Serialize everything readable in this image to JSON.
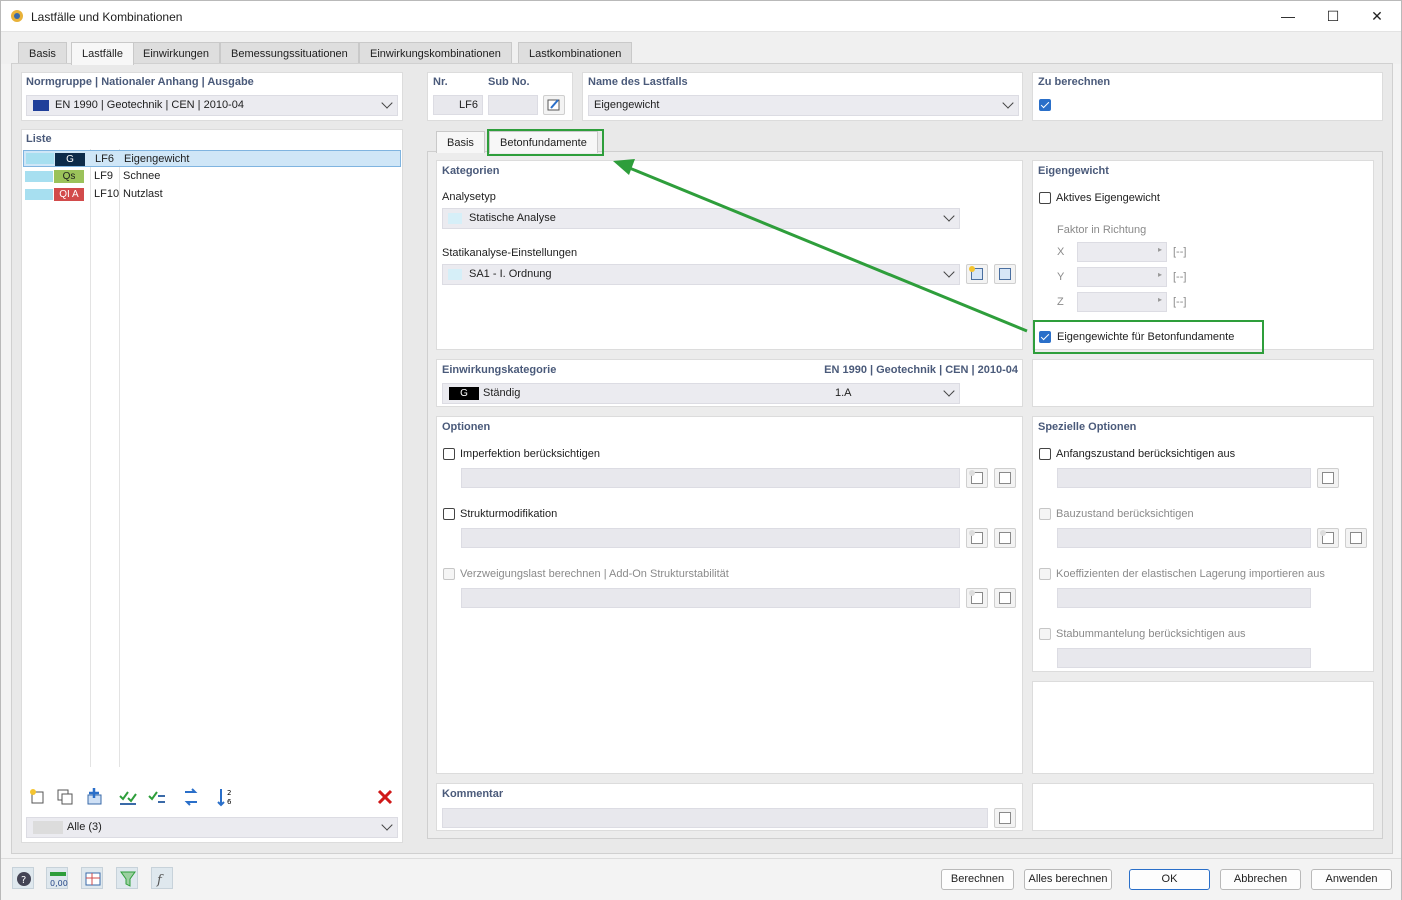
{
  "window": {
    "title": "Lastfälle und Kombinationen",
    "minimize": "—",
    "maximize": "☐",
    "close": "✕"
  },
  "tabs": [
    "Basis",
    "Lastfälle",
    "Einwirkungen",
    "Bemessungssituationen",
    "Einwirkungskombinationen",
    "Lastkombinationen"
  ],
  "active_tab": "Lastfälle",
  "left": {
    "norm_header": "Normgruppe | Nationaler Anhang | Ausgabe",
    "norm_value": "EN 1990 | Geotechnik | CEN | 2010-04",
    "list_header": "Liste",
    "items": [
      {
        "badge": "G",
        "no": "LF6",
        "name": "Eigengewicht",
        "badge_bg": "#0c2b4a",
        "badge_fg": "#ffffff"
      },
      {
        "badge": "Qs",
        "no": "LF9",
        "name": "Schnee",
        "badge_bg": "#9bc25a",
        "badge_fg": "#1e1e1e"
      },
      {
        "badge": "QI A",
        "no": "LF10",
        "name": "Nutzlast",
        "badge_bg": "#d24b4b",
        "badge_fg": "#ffffff"
      }
    ],
    "filter": "Alle (3)"
  },
  "top": {
    "nr_label": "Nr.",
    "nr_value": "LF6",
    "sub_label": "Sub No.",
    "name_label": "Name des Lastfalls",
    "name_value": "Eigengewicht",
    "calc_label": "Zu berechnen",
    "calc_checked": true
  },
  "subtabs": [
    "Basis",
    "Betonfundamente"
  ],
  "kategorien": {
    "header": "Kategorien",
    "analysetyp_label": "Analysetyp",
    "analysetyp_value": "Statische Analyse",
    "statik_label": "Statikanalyse-Einstellungen",
    "statik_value": "SA1 - I. Ordnung"
  },
  "eigengewicht": {
    "header": "Eigengewicht",
    "aktiv_label": "Aktives Eigengewicht",
    "aktiv_checked": false,
    "faktor_label": "Faktor in Richtung",
    "axes": [
      "X",
      "Y",
      "Z"
    ],
    "unit": "[--]",
    "beton_label": "Eigengewichte für Betonfundamente",
    "beton_checked": true
  },
  "einwirkung": {
    "header": "Einwirkungskategorie",
    "norm": "EN 1990 | Geotechnik | CEN | 2010-04",
    "badge": "G",
    "value": "Ständig",
    "code": "1.A"
  },
  "optionen": {
    "header": "Optionen",
    "items": [
      {
        "label": "Imperfektion berücksichtigen",
        "enabled": true
      },
      {
        "label": "Strukturmodifikation",
        "enabled": true
      },
      {
        "label": "Verzweigungslast berechnen | Add-On Strukturstabilität",
        "enabled": false
      }
    ]
  },
  "spezielle": {
    "header": "Spezielle Optionen",
    "items": [
      {
        "label": "Anfangszustand berücksichtigen aus",
        "enabled": true
      },
      {
        "label": "Bauzustand berücksichtigen",
        "enabled": false
      },
      {
        "label": "Koeffizienten der elastischen Lagerung importieren aus",
        "enabled": false
      },
      {
        "label": "Stabummantelung berücksichtigen aus",
        "enabled": false
      }
    ]
  },
  "kommentar": {
    "header": "Kommentar"
  },
  "buttons": {
    "berechnen": "Berechnen",
    "alles": "Alles berechnen",
    "ok": "OK",
    "abbrechen": "Abbrechen",
    "anwenden": "Anwenden"
  },
  "accent": "#2e9e3b"
}
